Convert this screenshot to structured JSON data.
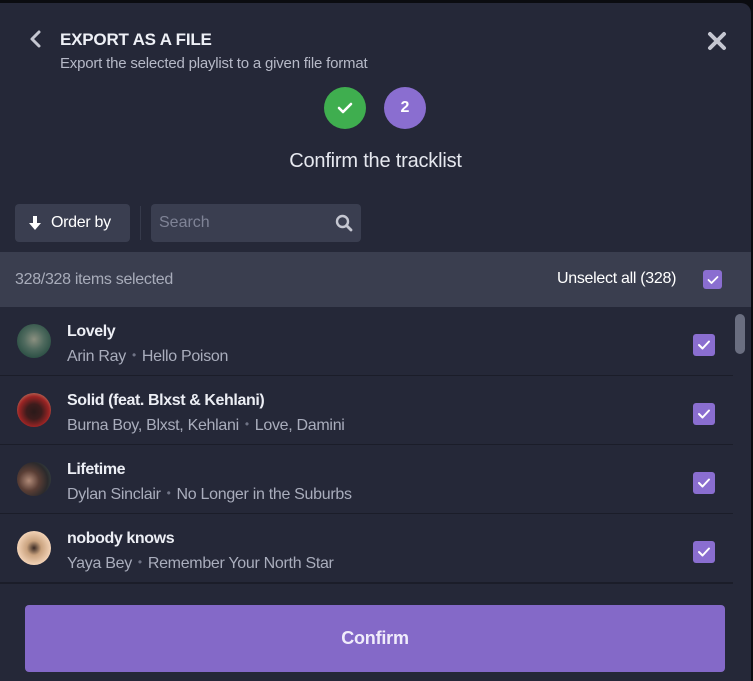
{
  "header": {
    "title": "EXPORT AS A FILE",
    "subtitle": "Export the selected playlist to a given file format",
    "back_icon": "chevron-left-icon",
    "close_icon": "close-icon"
  },
  "steps": [
    {
      "state": "done",
      "label": "",
      "icon": "check-icon",
      "color": "#3fae4f"
    },
    {
      "state": "current",
      "label": "2",
      "color": "#8a6ed0"
    }
  ],
  "step_heading": "Confirm the tracklist",
  "toolbar": {
    "order_by_label": "Order by",
    "order_icon": "arrow-down-icon",
    "search_placeholder": "Search",
    "search_value": ""
  },
  "selection": {
    "count_text": "328/328 items selected",
    "unselect_all_label": "Unselect all (328)",
    "all_checked": true
  },
  "tracks": [
    {
      "title": "Lovely",
      "artists": "Arin Ray",
      "album": "Hello Poison",
      "checked": true
    },
    {
      "title": "Solid (feat. Blxst & Kehlani)",
      "artists": "Burna Boy, Blxst, Kehlani",
      "album": "Love, Damini",
      "checked": true
    },
    {
      "title": "Lifetime",
      "artists": "Dylan Sinclair",
      "album": "No Longer in the Suburbs",
      "checked": true
    },
    {
      "title": "nobody knows",
      "artists": "Yaya Bey",
      "album": "Remember Your North Star",
      "checked": true
    }
  ],
  "separator": "•",
  "confirm_label": "Confirm",
  "colors": {
    "accent": "#8469c8",
    "success": "#3fae4f",
    "background": "#252838"
  }
}
